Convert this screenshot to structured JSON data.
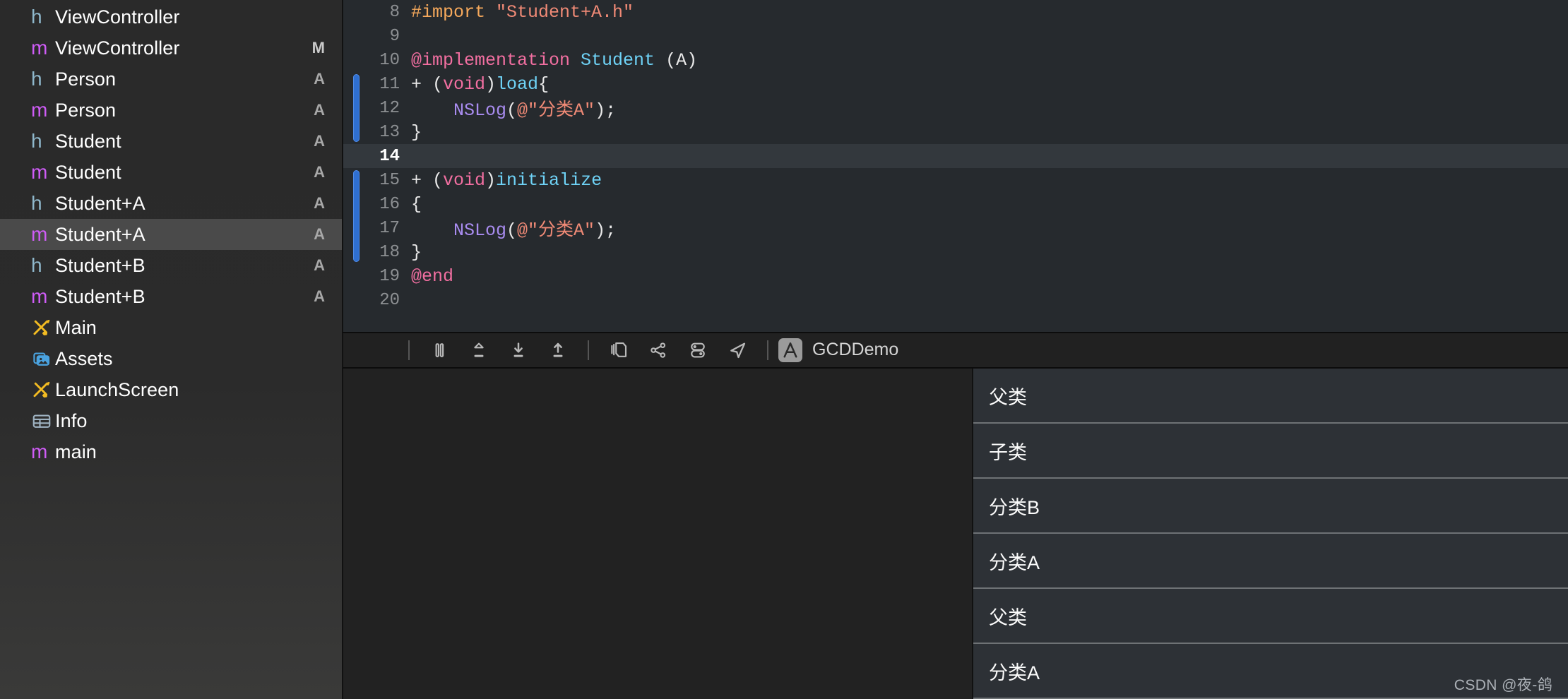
{
  "sidebar": {
    "items": [
      {
        "icon": "h-file-icon",
        "kind": "h",
        "label": "ViewController",
        "badge": "",
        "selected": false
      },
      {
        "icon": "m-file-icon",
        "kind": "m",
        "label": "ViewController",
        "badge": "M",
        "selected": false
      },
      {
        "icon": "h-file-icon",
        "kind": "h",
        "label": "Person",
        "badge": "A",
        "selected": false
      },
      {
        "icon": "m-file-icon",
        "kind": "m",
        "label": "Person",
        "badge": "A",
        "selected": false
      },
      {
        "icon": "h-file-icon",
        "kind": "h",
        "label": "Student",
        "badge": "A",
        "selected": false
      },
      {
        "icon": "m-file-icon",
        "kind": "m",
        "label": "Student",
        "badge": "A",
        "selected": false
      },
      {
        "icon": "h-file-icon",
        "kind": "h",
        "label": "Student+A",
        "badge": "A",
        "selected": false
      },
      {
        "icon": "m-file-icon",
        "kind": "m",
        "label": "Student+A",
        "badge": "A",
        "selected": true
      },
      {
        "icon": "h-file-icon",
        "kind": "h",
        "label": "Student+B",
        "badge": "A",
        "selected": false
      },
      {
        "icon": "m-file-icon",
        "kind": "m",
        "label": "Student+B",
        "badge": "A",
        "selected": false
      },
      {
        "icon": "storyboard-icon",
        "kind": "board",
        "label": "Main",
        "badge": "",
        "selected": false
      },
      {
        "icon": "assets-catalog-icon",
        "kind": "assets",
        "label": "Assets",
        "badge": "",
        "selected": false
      },
      {
        "icon": "storyboard-icon",
        "kind": "board",
        "label": "LaunchScreen",
        "badge": "",
        "selected": false
      },
      {
        "icon": "plist-table-icon",
        "kind": "plist",
        "label": "Info",
        "badge": "",
        "selected": false
      },
      {
        "icon": "m-file-icon",
        "kind": "m",
        "label": "main",
        "badge": "",
        "selected": false
      }
    ]
  },
  "editor": {
    "lines": [
      {
        "no": "8",
        "mark": false,
        "current": false,
        "tokens": [
          {
            "t": "#import ",
            "c": "k-pre"
          },
          {
            "t": "\"Student+A.h\"",
            "c": "k-str"
          }
        ]
      },
      {
        "no": "9",
        "mark": false,
        "current": false,
        "tokens": []
      },
      {
        "no": "10",
        "mark": false,
        "current": false,
        "tokens": [
          {
            "t": "@implementation ",
            "c": "k-kw"
          },
          {
            "t": "Student",
            "c": "k-type"
          },
          {
            "t": " (A)",
            "c": "k-plain"
          }
        ]
      },
      {
        "no": "11",
        "mark": true,
        "current": false,
        "tokens": [
          {
            "t": "+ (",
            "c": "k-plain"
          },
          {
            "t": "void",
            "c": "k-kw"
          },
          {
            "t": ")",
            "c": "k-plain"
          },
          {
            "t": "load",
            "c": "k-type"
          },
          {
            "t": "{",
            "c": "k-plain"
          }
        ]
      },
      {
        "no": "12",
        "mark": true,
        "current": false,
        "tokens": [
          {
            "t": "    ",
            "c": "k-plain"
          },
          {
            "t": "NSLog",
            "c": "k-fn"
          },
          {
            "t": "(",
            "c": "k-plain"
          },
          {
            "t": "@\"分类A\"",
            "c": "k-str"
          },
          {
            "t": ");",
            "c": "k-plain"
          }
        ]
      },
      {
        "no": "13",
        "mark": true,
        "current": false,
        "tokens": [
          {
            "t": "}",
            "c": "k-plain"
          }
        ]
      },
      {
        "no": "14",
        "mark": false,
        "current": true,
        "tokens": []
      },
      {
        "no": "15",
        "mark": true,
        "current": false,
        "tokens": [
          {
            "t": "+ (",
            "c": "k-plain"
          },
          {
            "t": "void",
            "c": "k-kw"
          },
          {
            "t": ")",
            "c": "k-plain"
          },
          {
            "t": "initialize",
            "c": "k-type"
          }
        ]
      },
      {
        "no": "16",
        "mark": true,
        "current": false,
        "tokens": [
          {
            "t": "{",
            "c": "k-plain"
          }
        ]
      },
      {
        "no": "17",
        "mark": true,
        "current": false,
        "tokens": [
          {
            "t": "    ",
            "c": "k-plain"
          },
          {
            "t": "NSLog",
            "c": "k-fn"
          },
          {
            "t": "(",
            "c": "k-plain"
          },
          {
            "t": "@\"分类A\"",
            "c": "k-str"
          },
          {
            "t": ");",
            "c": "k-plain"
          }
        ]
      },
      {
        "no": "18",
        "mark": true,
        "current": false,
        "tokens": [
          {
            "t": "}",
            "c": "k-plain"
          }
        ]
      },
      {
        "no": "19",
        "mark": false,
        "current": false,
        "tokens": [
          {
            "t": "@end",
            "c": "k-kw"
          }
        ]
      },
      {
        "no": "20",
        "mark": false,
        "current": false,
        "tokens": []
      }
    ]
  },
  "debug_toolbar": {
    "buttons": [
      {
        "name": "stop-button",
        "glyph": "stop"
      },
      {
        "name": "separator-1",
        "glyph": "sep"
      },
      {
        "name": "pause-button",
        "glyph": "pause"
      },
      {
        "name": "step-over-button",
        "glyph": "step-over"
      },
      {
        "name": "step-into-button",
        "glyph": "step-into"
      },
      {
        "name": "step-out-button",
        "glyph": "step-out"
      },
      {
        "name": "separator-2",
        "glyph": "sep"
      },
      {
        "name": "view-hierarchy-button",
        "glyph": "layers"
      },
      {
        "name": "memory-graph-button",
        "glyph": "graph"
      },
      {
        "name": "environment-overrides-button",
        "glyph": "toggles"
      },
      {
        "name": "simulate-location-button",
        "glyph": "location"
      },
      {
        "name": "separator-3",
        "glyph": "sep"
      }
    ],
    "app_icon": "xcode-app-icon",
    "scheme": "GCDDemo"
  },
  "console": {
    "rows": [
      {
        "text": "父类"
      },
      {
        "text": "子类"
      },
      {
        "text": "分类B"
      },
      {
        "text": "分类A"
      },
      {
        "text": "父类"
      },
      {
        "text": "分类A"
      }
    ]
  },
  "watermark": {
    "text": "CSDN @夜-鸽"
  },
  "colors": {
    "accent_blue": "#2f7cf6",
    "selection_gray": "#4a4a4a",
    "editor_bg": "#262a2e",
    "console_bg": "#2d3136",
    "keyword_pink": "#f26fa1",
    "type_cyan": "#6fd3f7",
    "string_salmon": "#f08a76",
    "fn_purple": "#a98cf0",
    "pre_orange": "#f6a95c"
  }
}
